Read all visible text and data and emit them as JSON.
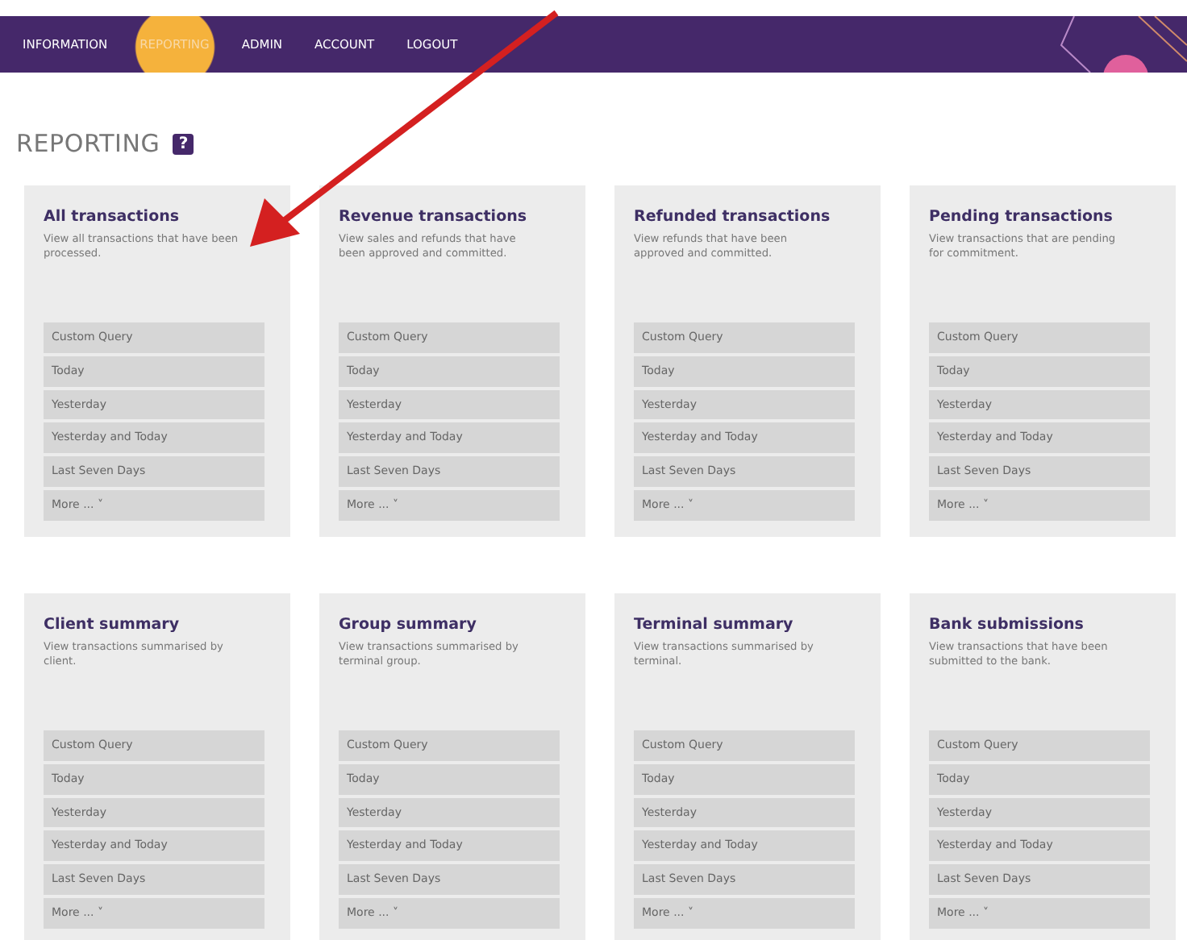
{
  "nav": [
    {
      "label": "INFORMATION",
      "selected": false
    },
    {
      "label": "REPORTING",
      "selected": true
    },
    {
      "label": "ADMIN",
      "selected": false
    },
    {
      "label": "ACCOUNT",
      "selected": false
    },
    {
      "label": "LOGOUT",
      "selected": false
    }
  ],
  "page_title": "REPORTING",
  "help": "?",
  "cards": [
    {
      "title": "All transactions",
      "description": "View all transactions that have been processed.",
      "options": [
        "Custom Query",
        "Today",
        "Yesterday",
        "Yesterday and Today",
        "Last Seven Days",
        "More ... ˅"
      ]
    },
    {
      "title": "Revenue transactions",
      "description": "View sales and refunds that have been approved and committed.",
      "options": [
        "Custom Query",
        "Today",
        "Yesterday",
        "Yesterday and Today",
        "Last Seven Days",
        "More ... ˅"
      ]
    },
    {
      "title": "Refunded transactions",
      "description": "View refunds that have been approved and committed.",
      "options": [
        "Custom Query",
        "Today",
        "Yesterday",
        "Yesterday and Today",
        "Last Seven Days",
        "More ... ˅"
      ]
    },
    {
      "title": "Pending transactions",
      "description": "View transactions that are pending for commitment.",
      "options": [
        "Custom Query",
        "Today",
        "Yesterday",
        "Yesterday and Today",
        "Last Seven Days",
        "More ... ˅"
      ]
    },
    {
      "title": "Client summary",
      "description": "View transactions summarised by client.",
      "options": [
        "Custom Query",
        "Today",
        "Yesterday",
        "Yesterday and Today",
        "Last Seven Days",
        "More ... ˅"
      ]
    },
    {
      "title": "Group summary",
      "description": "View transactions summarised by terminal group.",
      "options": [
        "Custom Query",
        "Today",
        "Yesterday",
        "Yesterday and Today",
        "Last Seven Days",
        "More ... ˅"
      ]
    },
    {
      "title": "Terminal summary",
      "description": "View transactions summarised by terminal.",
      "options": [
        "Custom Query",
        "Today",
        "Yesterday",
        "Yesterday and Today",
        "Last Seven Days",
        "More ... ˅"
      ]
    },
    {
      "title": "Bank submissions",
      "description": "View transactions that have been submitted to the bank.",
      "options": [
        "Custom Query",
        "Today",
        "Yesterday",
        "Yesterday and Today",
        "Last Seven Days",
        "More ... ˅"
      ]
    }
  ]
}
